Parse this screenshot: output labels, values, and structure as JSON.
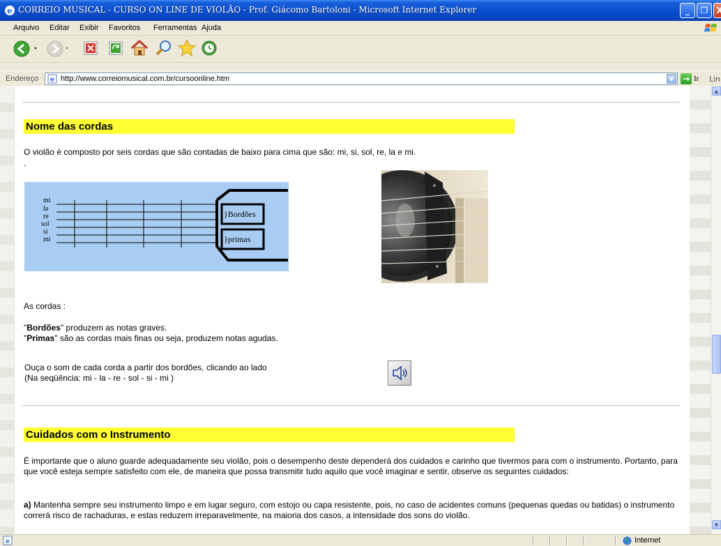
{
  "window": {
    "title": "CORREIO MUSICAL - CURSO ON LINE DE VIOLÃO - Prof. Giácomo Bartoloni - Microsoft Internet Explorer",
    "minimize_label": "_",
    "maximize_label": "❐",
    "close_label": "X"
  },
  "menubar": {
    "items": [
      "Arquivo",
      "Editar",
      "Exibir",
      "Favoritos",
      "Ferramentas",
      "Ajuda"
    ]
  },
  "toolbar": {
    "icons": [
      "back-icon",
      "forward-icon",
      "stop-icon",
      "refresh-icon",
      "home-icon",
      "search-icon",
      "favorites-icon",
      "history-icon"
    ]
  },
  "addressbar": {
    "label": "Endereço",
    "url": "http://www.correiomusical.com.br/cursoonline.htm",
    "go_label": "Ir",
    "links_label": "Links"
  },
  "content": {
    "section1": {
      "heading": "Nome das cordas",
      "intro": "O violão é composto por seis cordas que são contadas de baixo para cima que são: mi, si, sol, re, la e mi.",
      "dot": ".",
      "diagram": {
        "strings": [
          "mi",
          "la",
          "re",
          "sol",
          "si",
          "mi"
        ],
        "bordoes_label": "}Bordões",
        "primas_label": "}primas"
      },
      "as_cordas": "As cordas :",
      "bordoes_term": "Bordões",
      "bordoes_desc": " produzem as notas graves.",
      "primas_term": "Primas",
      "primas_desc": " são as cordas mais finas ou seja, produzem notas agudas.",
      "listen_line1": "Ouça o som de cada corda a partir dos bordões, clicando ao lado",
      "listen_line2": "(Na seqüência: mi - la - re - sol - si - mi )"
    },
    "section2": {
      "heading": "Cuidados com o Instrumento",
      "para1": "É importante que o aluno guarde adequadamente seu violão, pois o desempenho deste dependerá dos cuidados e carinho que tivermos para com o instrumento. Portanto, para que você esteja sempre satisfeito com ele, de maneira que possa transmitir tudo aquilo que você imaginar e sentir, observe os seguintes cuidados:",
      "item_a_label": "a)",
      "item_a_text": " Mantenha sempre seu instrumento limpo e em lugar seguro, com estojo ou capa resistente, pois, no caso de acidentes comuns (pequenas quedas ou batidas) o instrumento correrá risco de rachaduras, e estas reduzem irreparavelmente, na maioria dos casos, a intensidade dos sons do violão."
    }
  },
  "statusbar": {
    "zone": "Internet"
  }
}
